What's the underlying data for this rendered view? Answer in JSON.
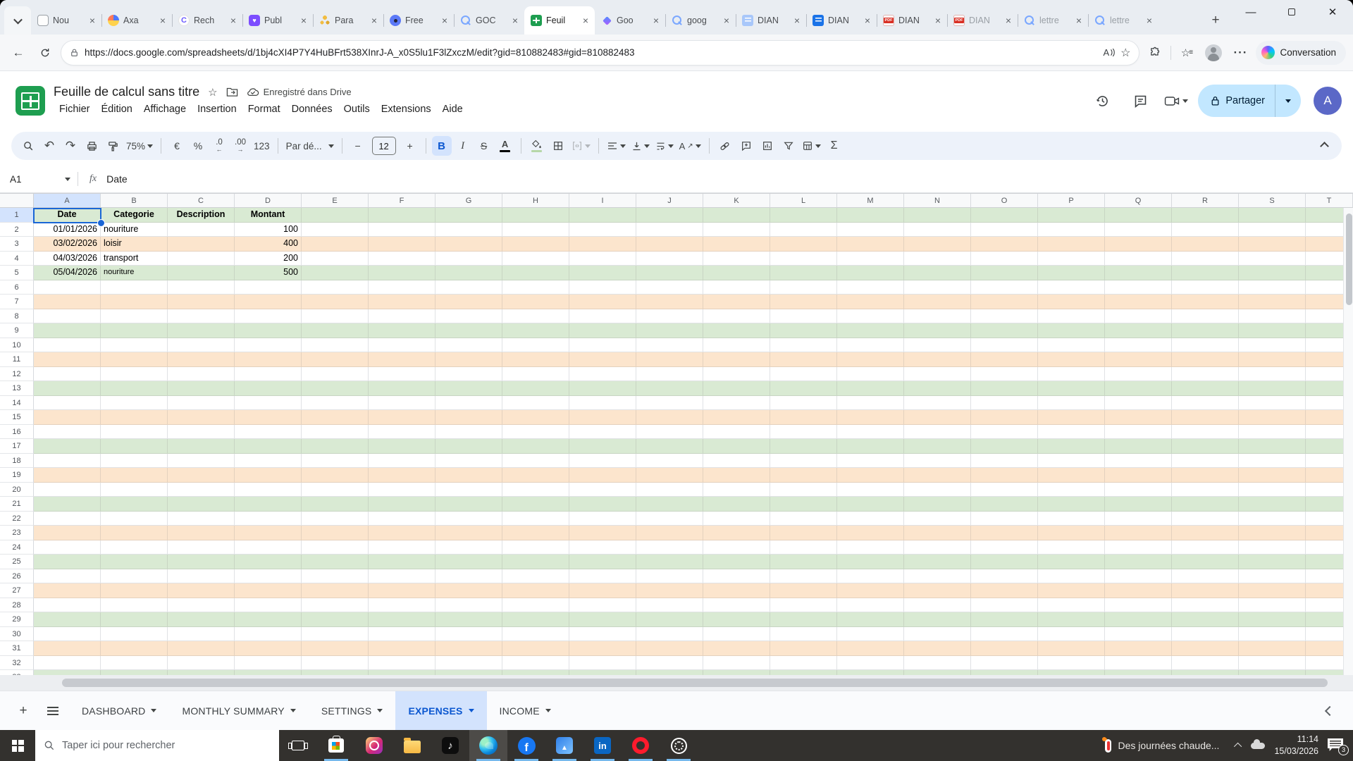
{
  "browser": {
    "tabs": [
      {
        "label": "Nou",
        "icon": "newtab",
        "active": false,
        "dim": false
      },
      {
        "label": "Axa",
        "icon": "axa",
        "active": false,
        "dim": false
      },
      {
        "label": "Rech",
        "icon": "copilot",
        "active": false,
        "dim": false
      },
      {
        "label": "Publ",
        "icon": "publ",
        "active": false,
        "dim": false
      },
      {
        "label": "Para",
        "icon": "para",
        "active": false,
        "dim": false
      },
      {
        "label": "Free",
        "icon": "free",
        "active": false,
        "dim": false
      },
      {
        "label": "GOC",
        "icon": "search",
        "active": false,
        "dim": false
      },
      {
        "label": "Feuil",
        "icon": "sheets",
        "active": true,
        "dim": false
      },
      {
        "label": "Goo",
        "icon": "gemini",
        "active": false,
        "dim": false
      },
      {
        "label": "goog",
        "icon": "search",
        "active": false,
        "dim": false
      },
      {
        "label": "DIAN",
        "icon": "docs-light",
        "active": false,
        "dim": false
      },
      {
        "label": "DIAN",
        "icon": "docs",
        "active": false,
        "dim": false
      },
      {
        "label": "DIAN",
        "icon": "pdf",
        "active": false,
        "dim": false
      },
      {
        "label": "DIAN",
        "icon": "pdf",
        "active": false,
        "dim": true
      },
      {
        "label": "lettre",
        "icon": "search",
        "active": false,
        "dim": true
      },
      {
        "label": "lettre",
        "icon": "search",
        "active": false,
        "dim": true
      }
    ],
    "url": "https://docs.google.com/spreadsheets/d/1bj4cXI4P7Y4HuBFrt538XInrJ-A_x0S5lu1F3lZxczM/edit?gid=810882483#gid=810882483",
    "read_aloud_glyph": "A",
    "copilot_label": "Conversation"
  },
  "sheets": {
    "doc_title": "Feuille de calcul sans titre",
    "saved_status": "Enregistré dans Drive",
    "menus": [
      "Fichier",
      "Édition",
      "Affichage",
      "Insertion",
      "Format",
      "Données",
      "Outils",
      "Extensions",
      "Aide"
    ],
    "share_label": "Partager",
    "avatar_letter": "A",
    "toolbar": {
      "zoom": "75%",
      "currency": "€",
      "percent": "%",
      "decrease_decimals": ".0",
      "increase_decimals": ".00",
      "more_formats": "123",
      "font_name": "Par dé...",
      "font_size": "12",
      "bold": "B",
      "italic": "I",
      "strikethrough": "S",
      "text_color": "A",
      "rotate": "A",
      "sum": "Σ"
    },
    "name_box": "A1",
    "formula_value": "Date"
  },
  "grid": {
    "columns": [
      "A",
      "B",
      "C",
      "D",
      "E",
      "F",
      "G",
      "H",
      "I",
      "J",
      "K",
      "L",
      "M",
      "N",
      "O",
      "P",
      "Q",
      "R",
      "S",
      "T"
    ],
    "selected_column": "A",
    "selected_row": 1,
    "num_rows": 33,
    "header_row": [
      "Date",
      "Categorie",
      "Description",
      "Montant"
    ],
    "data_rows": [
      {
        "row": 2,
        "date": "01/01/2026",
        "categorie": "nouriture",
        "description": "",
        "montant": "100",
        "small": false
      },
      {
        "row": 3,
        "date": "03/02/2026",
        "categorie": "loisir",
        "description": "",
        "montant": "400",
        "small": false
      },
      {
        "row": 4,
        "date": "04/03/2026",
        "categorie": "transport",
        "description": "",
        "montant": "200",
        "small": false
      },
      {
        "row": 5,
        "date": "05/04/2026",
        "categorie": "nouriture",
        "description": "",
        "montant": "500",
        "small": true
      }
    ],
    "band_green": "#d9ead3",
    "band_orange": "#fce5cd",
    "selection_color": "#1a66d6"
  },
  "sheet_tabs": [
    {
      "label": "DASHBOARD",
      "active": false
    },
    {
      "label": "MONTHLY SUMMARY",
      "active": false
    },
    {
      "label": "SETTINGS",
      "active": false
    },
    {
      "label": "EXPENSES",
      "active": true
    },
    {
      "label": "INCOME",
      "active": false
    }
  ],
  "taskbar": {
    "search_placeholder": "Taper ici pour rechercher",
    "apps": [
      {
        "name": "task-view",
        "running": false,
        "active": false
      },
      {
        "name": "store",
        "running": true,
        "active": false
      },
      {
        "name": "instagram",
        "running": false,
        "active": false
      },
      {
        "name": "explorer",
        "running": false,
        "active": false
      },
      {
        "name": "tiktok",
        "running": false,
        "active": false
      },
      {
        "name": "edge",
        "running": true,
        "active": true
      },
      {
        "name": "facebook",
        "running": true,
        "active": false
      },
      {
        "name": "photos",
        "running": true,
        "active": false
      },
      {
        "name": "linkedin",
        "running": true,
        "active": false
      },
      {
        "name": "opera",
        "running": true,
        "active": false
      },
      {
        "name": "chatgpt",
        "running": true,
        "active": false
      }
    ],
    "weather_text": "Des journées chaude...",
    "time": "11:14",
    "date": "15/03/2026",
    "notification_count": "3"
  }
}
